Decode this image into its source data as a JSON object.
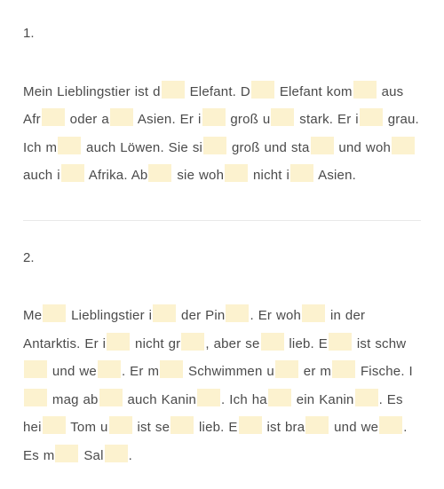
{
  "questions": [
    {
      "number": "1.",
      "segments": [
        {
          "t": "Mein Lieblingstier ist d"
        },
        {
          "b": true
        },
        {
          "t": " Elefant. D"
        },
        {
          "b": true
        },
        {
          "t": " Elefant kom"
        },
        {
          "b": true
        },
        {
          "t": " aus Afr"
        },
        {
          "b": true
        },
        {
          "t": " oder a"
        },
        {
          "b": true
        },
        {
          "t": " Asien. Er i"
        },
        {
          "b": true
        },
        {
          "t": " groß u"
        },
        {
          "b": true
        },
        {
          "t": " stark. Er i"
        },
        {
          "b": true
        },
        {
          "t": " grau. Ich m"
        },
        {
          "b": true
        },
        {
          "t": " auch Löwen. Sie si"
        },
        {
          "b": true
        },
        {
          "t": " groß und sta"
        },
        {
          "b": true
        },
        {
          "t": " und woh"
        },
        {
          "b": true
        },
        {
          "t": " auch i"
        },
        {
          "b": true
        },
        {
          "t": " Afrika. Ab"
        },
        {
          "b": true
        },
        {
          "t": " sie woh"
        },
        {
          "b": true
        },
        {
          "t": " nicht i"
        },
        {
          "b": true
        },
        {
          "t": " Asien."
        }
      ]
    },
    {
      "number": "2.",
      "segments": [
        {
          "t": "Me"
        },
        {
          "b": true
        },
        {
          "t": " Lieblingstier i"
        },
        {
          "b": true
        },
        {
          "t": " der Pin"
        },
        {
          "b": true
        },
        {
          "t": ". Er woh"
        },
        {
          "b": true
        },
        {
          "t": " in der Antarktis. Er i"
        },
        {
          "b": true
        },
        {
          "t": " nicht gr"
        },
        {
          "b": true
        },
        {
          "t": ", aber se"
        },
        {
          "b": true
        },
        {
          "t": " lieb. E"
        },
        {
          "b": true
        },
        {
          "t": " ist schw"
        },
        {
          "b": true
        },
        {
          "t": " und we"
        },
        {
          "b": true
        },
        {
          "t": ". Er m"
        },
        {
          "b": true
        },
        {
          "t": " Schwimmen u"
        },
        {
          "b": true
        },
        {
          "t": " er m"
        },
        {
          "b": true
        },
        {
          "t": " Fische. I"
        },
        {
          "b": true
        },
        {
          "t": " mag ab"
        },
        {
          "b": true
        },
        {
          "t": " auch Kanin"
        },
        {
          "b": true
        },
        {
          "t": ". Ich ha"
        },
        {
          "b": true
        },
        {
          "t": " ein Kanin"
        },
        {
          "b": true
        },
        {
          "t": ". Es hei"
        },
        {
          "b": true
        },
        {
          "t": " Tom u"
        },
        {
          "b": true
        },
        {
          "t": " ist se"
        },
        {
          "b": true
        },
        {
          "t": " lieb. E"
        },
        {
          "b": true
        },
        {
          "t": " ist bra"
        },
        {
          "b": true
        },
        {
          "t": " und we"
        },
        {
          "b": true
        },
        {
          "t": ". Es m"
        },
        {
          "b": true
        },
        {
          "t": " Sal"
        },
        {
          "b": true
        },
        {
          "t": "."
        }
      ]
    }
  ]
}
